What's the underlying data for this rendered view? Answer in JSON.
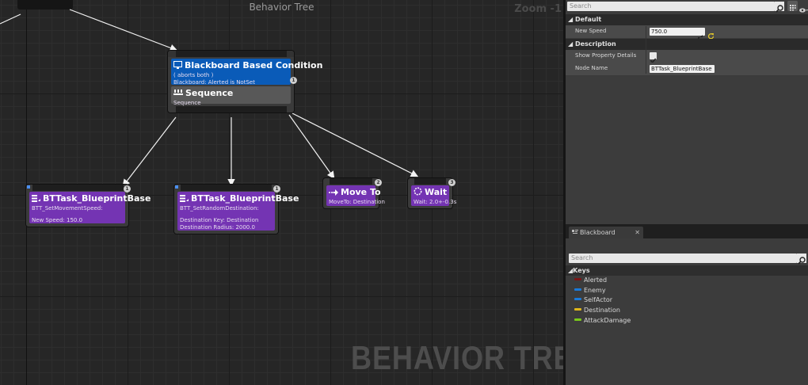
{
  "graph": {
    "title": "Behavior Tree",
    "zoom": "Zoom -1",
    "watermark": "BEHAVIOR TREE"
  },
  "nodes": {
    "selector": {
      "decorator_title": "Blackboard Based Condition",
      "decorator_line1": "( aborts both )",
      "decorator_line2": "Blackboard: Alerted is NotSet",
      "title": "Sequence",
      "subtitle": "Sequence",
      "badge": "1"
    },
    "task1": {
      "title": "BTTask_BlueprintBase",
      "line1": "BTT_SetMovementSpeed:",
      "line2": "New Speed: 150.0",
      "badge": "1"
    },
    "task2": {
      "title": "BTTask_BlueprintBase",
      "line1": "BTT_SetRandomDestination:",
      "line2": "Destination Key: Destination",
      "line3": "Destination Radius: 2000.0",
      "badge": "1"
    },
    "moveto": {
      "title": "Move To",
      "line1": "MoveTo: Destination",
      "badge": "2"
    },
    "wait": {
      "title": "Wait",
      "line1": "Wait: 2.0+-0.3s",
      "badge": "3"
    }
  },
  "details": {
    "search_placeholder": "Search",
    "default_header": "Default",
    "new_speed_label": "New Speed",
    "new_speed_value": "750.0",
    "description_header": "Description",
    "show_details_label": "Show Property Details",
    "node_name_label": "Node Name",
    "node_name_value": "BTTask_BlueprintBase"
  },
  "blackboard": {
    "tab_label": "Blackboard",
    "search_placeholder": "Search",
    "keys_header": "Keys",
    "keys": [
      {
        "name": "Alerted",
        "color": "#7a1515"
      },
      {
        "name": "Enemy",
        "color": "#1a7ad8"
      },
      {
        "name": "SelfActor",
        "color": "#1a7ad8"
      },
      {
        "name": "Destination",
        "color": "#e0b81a"
      },
      {
        "name": "AttackDamage",
        "color": "#7ac81a"
      }
    ]
  }
}
